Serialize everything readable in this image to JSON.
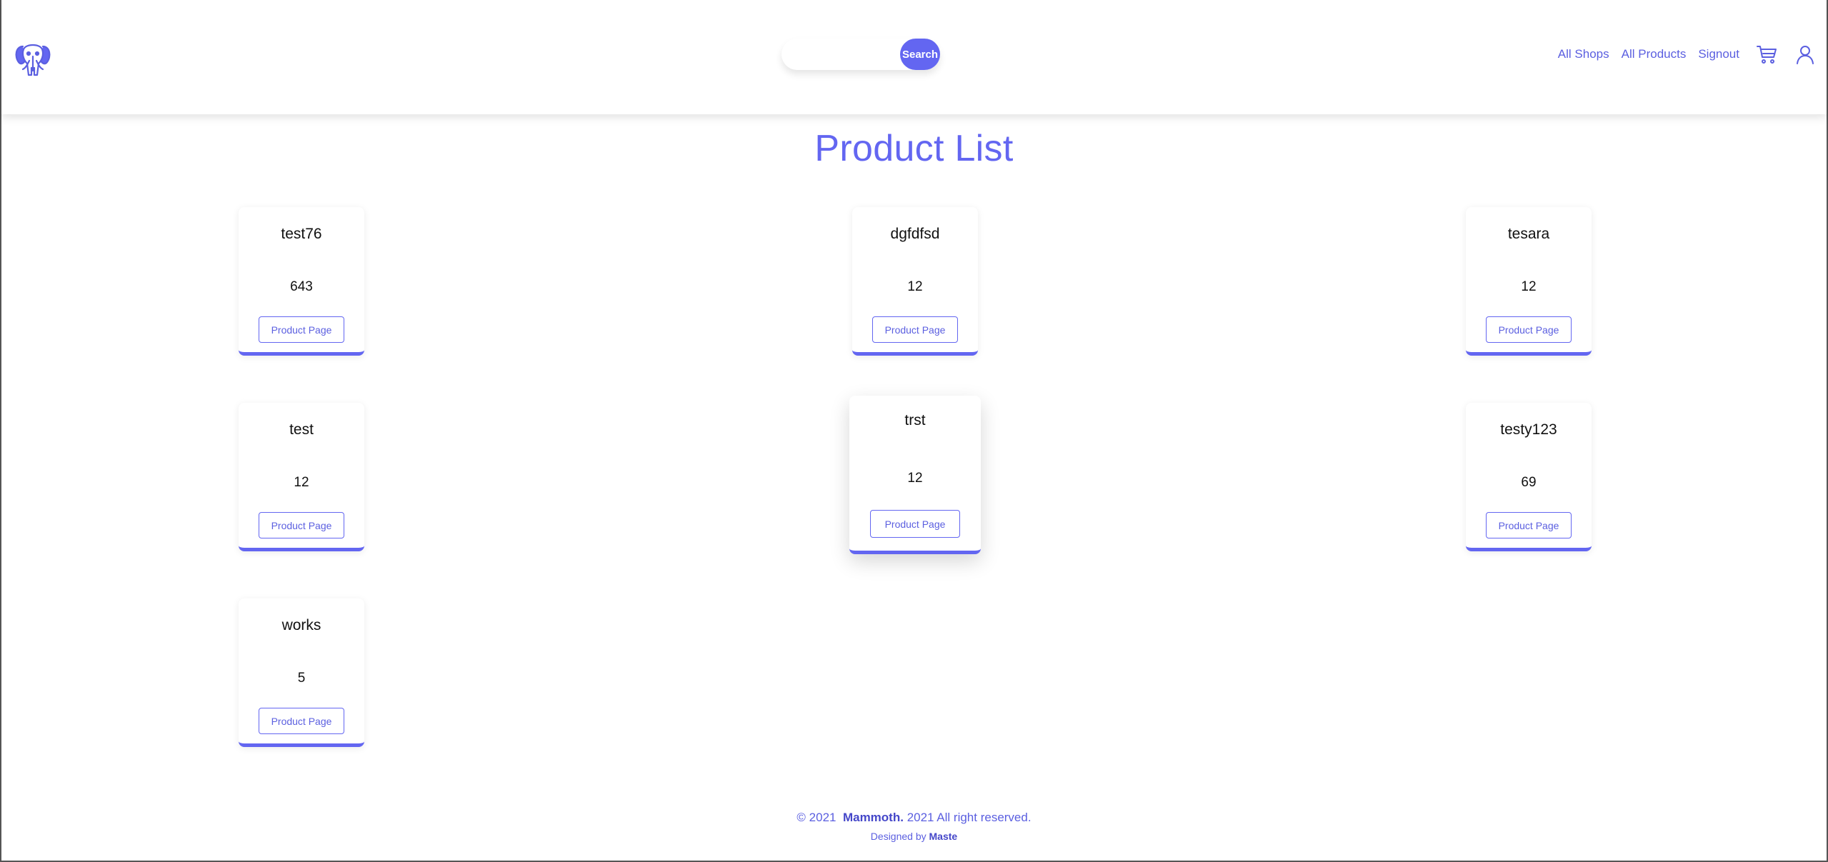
{
  "header": {
    "logo_icon": "elephant-logo-icon",
    "search": {
      "placeholder": "",
      "value": "",
      "button_label": "Search"
    },
    "nav": {
      "all_shops": "All Shops",
      "all_products": "All Products",
      "signout": "Signout",
      "cart_icon": "cart-icon",
      "user_icon": "user-icon"
    }
  },
  "main": {
    "title": "Product List",
    "products": [
      {
        "name": "test76",
        "value": "643",
        "button": "Product Page"
      },
      {
        "name": "dgfdfsd",
        "value": "12",
        "button": "Product Page"
      },
      {
        "name": "tesara",
        "value": "12",
        "button": "Product Page"
      },
      {
        "name": "test",
        "value": "12",
        "button": "Product Page"
      },
      {
        "name": "trst",
        "value": "12",
        "button": "Product Page"
      },
      {
        "name": "testy123",
        "value": "69",
        "button": "Product Page"
      },
      {
        "name": "works",
        "value": "5",
        "button": "Product Page"
      }
    ]
  },
  "footer": {
    "copyright_prefix": "© 2021",
    "brand": "Mammoth.",
    "copyright_suffix": "2021 All right reserved.",
    "designed_by_prefix": "Designed by",
    "designer": "Maste"
  },
  "colors": {
    "accent": "#6366f1",
    "text": "#111111",
    "background": "#ffffff"
  }
}
